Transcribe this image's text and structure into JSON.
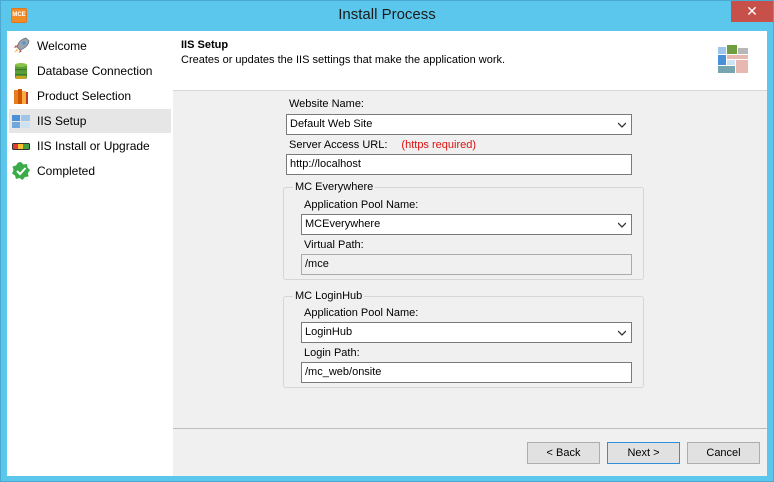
{
  "window": {
    "title": "Install Process",
    "app_icon_text": "MCE",
    "close_glyph": "✕"
  },
  "sidebar": {
    "items": [
      {
        "label": "Welcome",
        "icon": "rocket-icon"
      },
      {
        "label": "Database Connection",
        "icon": "database-icon"
      },
      {
        "label": "Product Selection",
        "icon": "books-icon"
      },
      {
        "label": "IIS Setup",
        "icon": "server-icon",
        "active": true
      },
      {
        "label": "IIS Install or Upgrade",
        "icon": "progress-bar-icon"
      },
      {
        "label": "Completed",
        "icon": "checkmark-badge-icon"
      }
    ]
  },
  "header": {
    "title": "IIS Setup",
    "description": "Creates or updates the IIS settings that make the application work.",
    "graphic_icon": "windows-tiles-icon"
  },
  "form": {
    "website_name_label": "Website Name:",
    "website_name_value": "Default Web Site",
    "server_url_label": "Server Access URL:",
    "server_url_note": "(https required)",
    "server_url_value": "http://localhost",
    "mc_everywhere": {
      "group_title": "MC Everywhere",
      "pool_label": "Application Pool Name:",
      "pool_value": "MCEverywhere",
      "path_label": "Virtual Path:",
      "path_value": "/mce"
    },
    "mc_loginhub": {
      "group_title": "MC LoginHub",
      "pool_label": "Application Pool Name:",
      "pool_value": "LoginHub",
      "path_label": "Login Path:",
      "path_value": "/mc_web/onsite"
    }
  },
  "buttons": {
    "back": "< Back",
    "next": "Next >",
    "cancel": "Cancel"
  },
  "colors": {
    "titlebar": "#5bc7ec",
    "close": "#c7504b",
    "required_note": "#dd1111",
    "panel": "#f0f0f0"
  }
}
